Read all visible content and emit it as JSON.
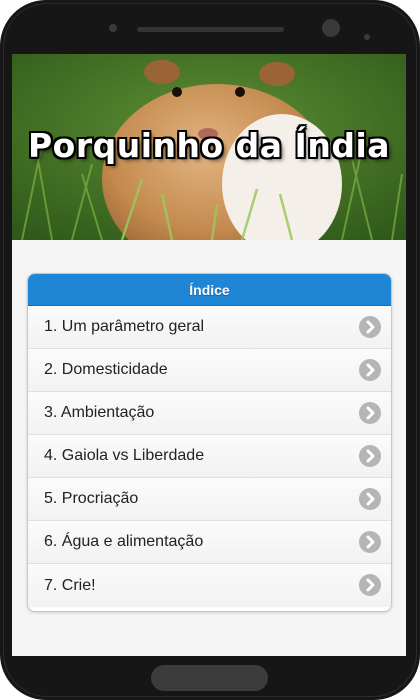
{
  "hero": {
    "title": "Porquinho da Índia"
  },
  "index": {
    "header": "Índice",
    "items": [
      {
        "label": "1. Um parâmetro geral"
      },
      {
        "label": "2. Domesticidade"
      },
      {
        "label": "3. Ambientação"
      },
      {
        "label": "4. Gaiola vs Liberdade"
      },
      {
        "label": "5. Procriação"
      },
      {
        "label": "6. Água e alimentação"
      },
      {
        "label": "7. Crie!"
      }
    ]
  },
  "colors": {
    "accent": "#1f86d6",
    "chevron": "#b5b5b5",
    "phone_body": "#161616"
  },
  "icons": {
    "list_item_arrow": "chevron-right-icon"
  }
}
